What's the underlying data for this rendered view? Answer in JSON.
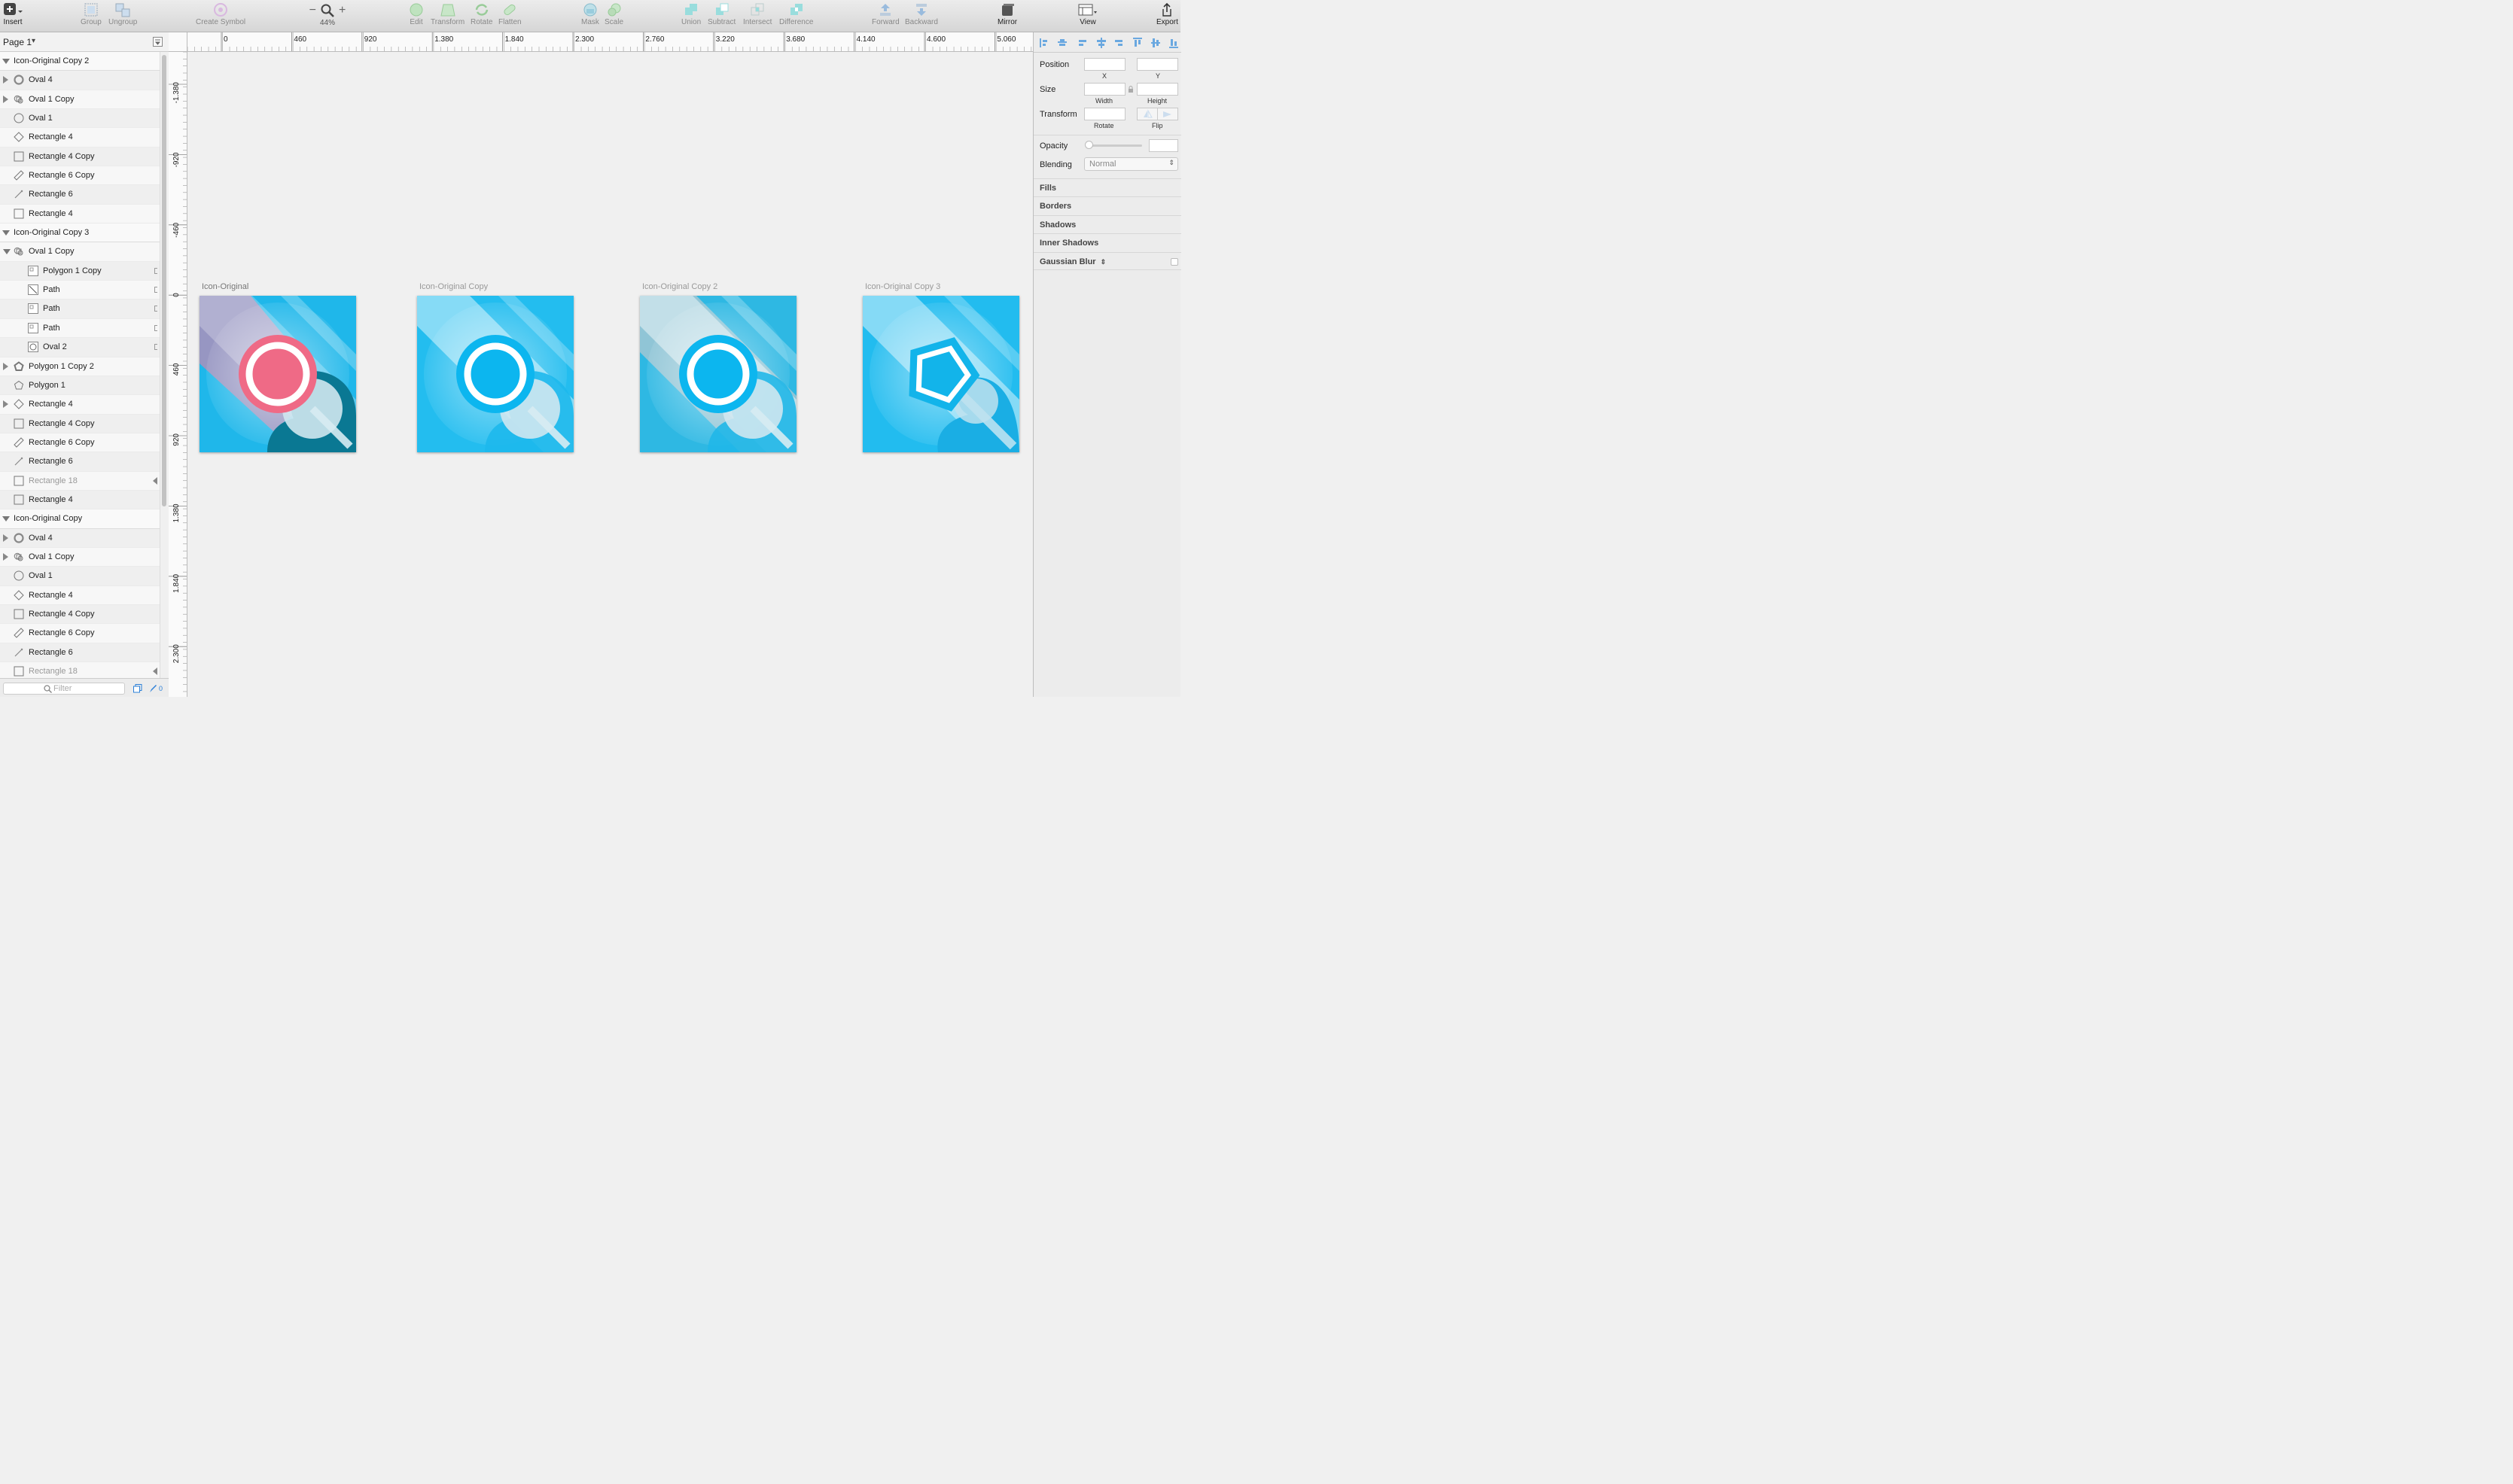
{
  "toolbar": {
    "insert": "Insert",
    "group": "Group",
    "ungroup": "Ungroup",
    "create_symbol": "Create Symbol",
    "zoom": "44%",
    "zoom_minus": "−",
    "zoom_plus": "+",
    "edit": "Edit",
    "transform": "Transform",
    "rotate": "Rotate",
    "flatten": "Flatten",
    "mask": "Mask",
    "scale": "Scale",
    "union": "Union",
    "subtract": "Subtract",
    "intersect": "Intersect",
    "difference": "Difference",
    "forward": "Forward",
    "backward": "Backward",
    "mirror": "Mirror",
    "view": "View",
    "export": "Export"
  },
  "page": {
    "label": "Page 1",
    "arrow": "▾"
  },
  "layers": [
    {
      "label": "Icon-Original Copy 2",
      "indent": 0,
      "type": "group",
      "tri": "open"
    },
    {
      "label": "Oval 4",
      "indent": 1,
      "type": "oval-border",
      "tri": "closed"
    },
    {
      "label": "Oval 1 Copy",
      "indent": 1,
      "type": "combined",
      "tri": "closed"
    },
    {
      "label": "Oval 1",
      "indent": 1,
      "type": "oval",
      "tri": ""
    },
    {
      "label": "Rectangle 4",
      "indent": 1,
      "type": "diamond",
      "tri": ""
    },
    {
      "label": "Rectangle 4 Copy",
      "indent": 1,
      "type": "rect",
      "tri": ""
    },
    {
      "label": "Rectangle 6 Copy",
      "indent": 1,
      "type": "slant",
      "tri": ""
    },
    {
      "label": "Rectangle 6",
      "indent": 1,
      "type": "line",
      "tri": ""
    },
    {
      "label": "Rectangle 4",
      "indent": 1,
      "type": "rect",
      "tri": ""
    },
    {
      "label": "Icon-Original Copy 3",
      "indent": 0,
      "type": "group",
      "tri": "open"
    },
    {
      "label": "Oval 1 Copy",
      "indent": 1,
      "type": "combined",
      "tri": "open"
    },
    {
      "label": "Polygon 1 Copy",
      "indent": 2,
      "type": "thumb",
      "tri": ""
    },
    {
      "label": "Path",
      "indent": 2,
      "type": "thumb-path",
      "tri": ""
    },
    {
      "label": "Path",
      "indent": 2,
      "type": "thumb",
      "tri": ""
    },
    {
      "label": "Path",
      "indent": 2,
      "type": "thumb",
      "tri": ""
    },
    {
      "label": "Oval 2",
      "indent": 2,
      "type": "thumb-oval",
      "tri": ""
    },
    {
      "label": "Polygon 1 Copy 2",
      "indent": 1,
      "type": "polygon-border",
      "tri": "closed"
    },
    {
      "label": "Polygon 1",
      "indent": 1,
      "type": "polygon",
      "tri": ""
    },
    {
      "label": "Rectangle 4",
      "indent": 1,
      "type": "diamond",
      "tri": "closed"
    },
    {
      "label": "Rectangle 4 Copy",
      "indent": 1,
      "type": "rect",
      "tri": ""
    },
    {
      "label": "Rectangle 6 Copy",
      "indent": 1,
      "type": "slant",
      "tri": ""
    },
    {
      "label": "Rectangle 6",
      "indent": 1,
      "type": "line",
      "tri": ""
    },
    {
      "label": "Rectangle 18",
      "indent": 1,
      "type": "rect",
      "tri": "",
      "dim": true
    },
    {
      "label": "Rectangle 4",
      "indent": 1,
      "type": "rect",
      "tri": ""
    },
    {
      "label": "Icon-Original Copy",
      "indent": 0,
      "type": "group",
      "tri": "open"
    },
    {
      "label": "Oval 4",
      "indent": 1,
      "type": "oval-border",
      "tri": "closed"
    },
    {
      "label": "Oval 1 Copy",
      "indent": 1,
      "type": "combined",
      "tri": "closed"
    },
    {
      "label": "Oval 1",
      "indent": 1,
      "type": "oval",
      "tri": ""
    },
    {
      "label": "Rectangle 4",
      "indent": 1,
      "type": "diamond",
      "tri": ""
    },
    {
      "label": "Rectangle 4 Copy",
      "indent": 1,
      "type": "rect",
      "tri": ""
    },
    {
      "label": "Rectangle 6 Copy",
      "indent": 1,
      "type": "slant",
      "tri": ""
    },
    {
      "label": "Rectangle 6",
      "indent": 1,
      "type": "line",
      "tri": ""
    },
    {
      "label": "Rectangle 18",
      "indent": 1,
      "type": "rect",
      "tri": "",
      "dim": true
    }
  ],
  "filter": {
    "placeholder": "Filter",
    "count": "0"
  },
  "ruler": {
    "h": [
      "0",
      "460",
      "920",
      "1.380",
      "1.840",
      "2.300",
      "2.760",
      "3.220",
      "3.680",
      "4.140",
      "4.600",
      "5.060"
    ],
    "v": [
      "-1.380",
      "-920",
      "-460",
      "0",
      "460",
      "920",
      "1.380",
      "1.840",
      "2.300"
    ]
  },
  "artboards": [
    {
      "label": "Icon-Original",
      "bg": "#1fb7ea",
      "accent": "#ef6a86"
    },
    {
      "label": "Icon-Original Copy",
      "bg": "#23bdef",
      "accent": "#0cb6ef"
    },
    {
      "label": "Icon-Original Copy 2",
      "bg": "#2eb8e3",
      "accent": "#0cb6ef"
    },
    {
      "label": "Icon-Original Copy 3",
      "bg": "#22bcef",
      "accent": "#12b4ea"
    }
  ],
  "inspector": {
    "position": "Position",
    "x": "X",
    "y": "Y",
    "size": "Size",
    "width": "Width",
    "height": "Height",
    "transform": "Transform",
    "rotate": "Rotate",
    "flip": "Flip",
    "opacity": "Opacity",
    "blending": "Blending",
    "blend_value": "Normal",
    "sections": [
      "Fills",
      "Borders",
      "Shadows",
      "Inner Shadows",
      "Gaussian Blur"
    ]
  }
}
